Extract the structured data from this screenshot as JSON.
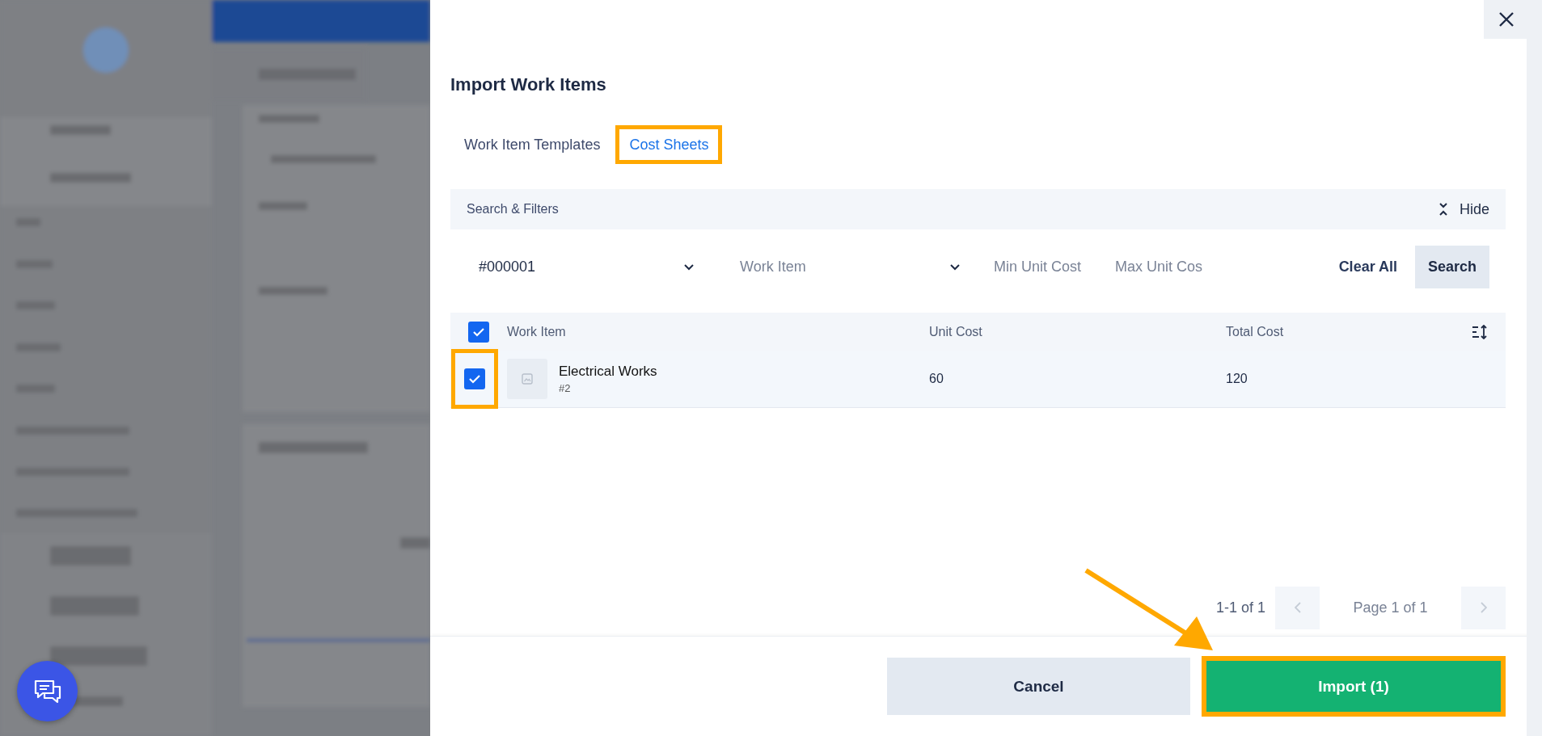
{
  "dialog": {
    "title": "Import Work Items"
  },
  "tabs": [
    {
      "label": "Work Item Templates",
      "selected": false,
      "highlighted": false
    },
    {
      "label": "Cost Sheets",
      "selected": true,
      "highlighted": true
    }
  ],
  "filters_bar": {
    "title": "Search & Filters",
    "toggle_label": "Hide"
  },
  "filters": [
    {
      "kind": "select",
      "value": "#000001"
    },
    {
      "kind": "select",
      "placeholder": "Work Item"
    },
    {
      "kind": "input",
      "placeholder": "Min Unit Cost"
    },
    {
      "kind": "input",
      "placeholder": "Max Unit Cos"
    }
  ],
  "filter_buttons": {
    "clear": "Clear All",
    "search": "Search"
  },
  "table": {
    "all_checked": true,
    "columns": [
      "Work Item",
      "Unit Cost",
      "Total Cost"
    ],
    "rows": [
      {
        "checked": true,
        "highlighted": true,
        "name": "Electrical Works",
        "code": "#2",
        "unit_cost": "60",
        "total_cost": "120"
      }
    ]
  },
  "pagination": {
    "range": "1-1 of 1",
    "page": "Page 1 of 1",
    "prev_disabled": true,
    "next_disabled": true
  },
  "footer": {
    "cancel": "Cancel",
    "import": "Import (1)",
    "import_highlighted": true
  }
}
